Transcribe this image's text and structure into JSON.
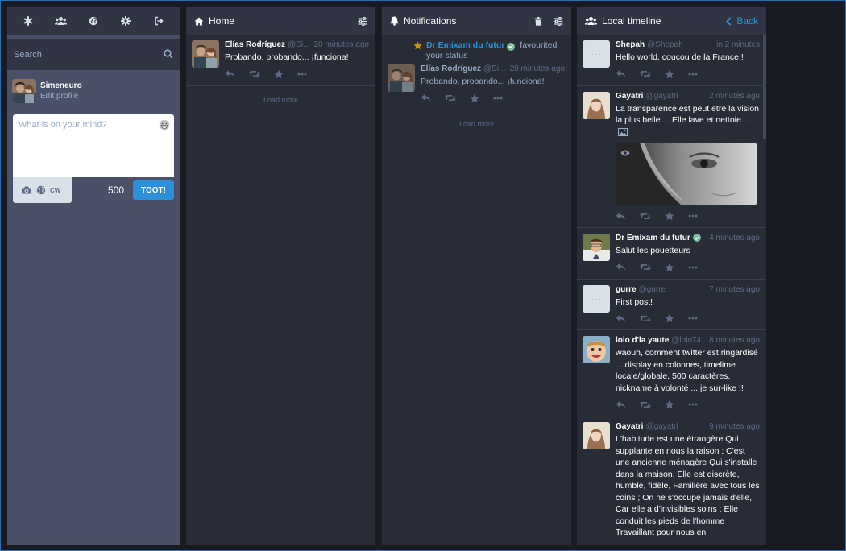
{
  "drawer": {
    "tabs": [
      "getting-started",
      "community",
      "public",
      "preferences",
      "logout"
    ],
    "search_placeholder": "Search",
    "profile": {
      "name": "Simeneuro",
      "edit_label": "Edit profile"
    },
    "compose": {
      "placeholder": "What is on your mind?",
      "cw_label": "CW",
      "char_count": "500",
      "toot_label": "TOOT!"
    }
  },
  "home": {
    "title": "Home",
    "statuses": [
      {
        "name": "Elías Rodríguez",
        "handle": "@Si...",
        "time": "20 minutes ago",
        "content": "Probando, probando... ¡funciona!"
      }
    ],
    "load_more": "Load more"
  },
  "notifications": {
    "title": "Notifications",
    "favourite": {
      "actor": "Dr Emixam du futur",
      "action_text": "favourited your status"
    },
    "status": {
      "name": "Elías Rodríguez",
      "handle": "@Si...",
      "time": "20 minutes ago",
      "content": "Probando, probando... ¡funciona!"
    },
    "load_more": "Load more"
  },
  "local": {
    "title": "Local timeline",
    "back_label": "Back",
    "statuses": [
      {
        "name": "Shepah",
        "handle": "@Shepah",
        "time": "in 2 minutes",
        "content": "Hello world, coucou de la France !"
      },
      {
        "name": "Gayatri",
        "handle": "@gayatri",
        "time": "2 minutes ago",
        "content": "La transparence est peut etre la vision la plus belle ....Elle lave et nettoie..."
      },
      {
        "name": "Dr Emixam du futur",
        "handle": "",
        "time": "4 minutes ago",
        "content": "Salut les pouetteurs"
      },
      {
        "name": "gurre",
        "handle": "@gurre",
        "time": "7 minutes ago",
        "content": "First post!"
      },
      {
        "name": "lolo d'la yaute",
        "handle": "@lolo74",
        "time": "8 minutes ago",
        "content": "waouh, comment twitter est ringardisé ... display en colonnes, timelime locale/globale, 500 caractères, nickname à volonté ... je sur-like !!"
      },
      {
        "name": "Gayatri",
        "handle": "@gayatri",
        "time": "9 minutes ago",
        "content": "L'habitude est une étrangère Qui supplante en nous la raison : C'est une ancienne ménagère Qui s'installe dans la maison. Elle est discrète, humble, fidèle, Familière avec tous les coins ; On ne s'occupe jamais d'elle, Car elle a d'invisibles soins : Elle conduit les pieds de l'homme Travaillant pour nous en"
      }
    ]
  },
  "colors": {
    "accent": "#2b90d9",
    "background": "#191b22",
    "column": "#282c37",
    "header": "#313543",
    "drawer": "#4a5067",
    "star": "#ca8f04",
    "verified": "#79bd9a"
  }
}
